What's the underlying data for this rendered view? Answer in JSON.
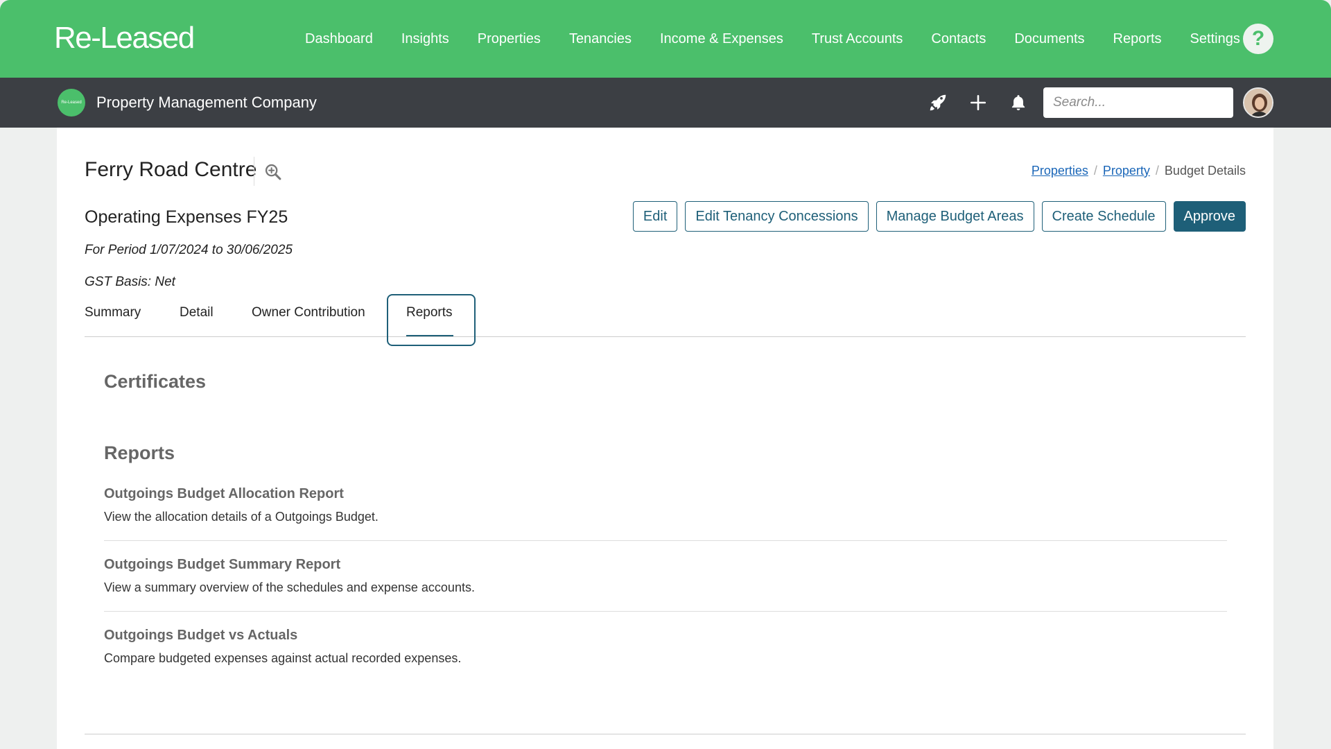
{
  "app": {
    "logo": "Re-Leased"
  },
  "topnav": {
    "items": [
      "Dashboard",
      "Insights",
      "Properties",
      "Tenancies",
      "Income & Expenses",
      "Trust Accounts",
      "Contacts",
      "Documents",
      "Reports",
      "Settings"
    ],
    "help_label": "?"
  },
  "companybar": {
    "logo_text": "Re-Leased",
    "company_name": "Property Management Company",
    "search_placeholder": "Search..."
  },
  "page": {
    "property_title": "Ferry Road Centre",
    "breadcrumb": [
      "Properties",
      "Property",
      "Budget Details"
    ],
    "budget_name": "Operating Expenses FY25",
    "period": "For Period 1/07/2024 to 30/06/2025",
    "gst_basis": "GST Basis: Net",
    "actions": [
      "Edit",
      "Edit Tenancy Concessions",
      "Manage Budget Areas",
      "Create Schedule",
      "Approve"
    ],
    "tabs": [
      "Summary",
      "Detail",
      "Owner Contribution",
      "Reports"
    ],
    "active_tab": "Reports"
  },
  "content": {
    "certificates_heading": "Certificates",
    "reports_heading": "Reports",
    "reports": [
      {
        "title": "Outgoings Budget Allocation Report",
        "desc": "View the allocation details of a Outgoings Budget."
      },
      {
        "title": "Outgoings Budget Summary Report",
        "desc": "View a summary overview of the schedules and expense accounts."
      },
      {
        "title": "Outgoings Budget vs Actuals",
        "desc": "Compare budgeted expenses against actual recorded expenses."
      }
    ]
  },
  "colors": {
    "brand_green": "#4bbf6b",
    "dark_bar": "#3c3f44",
    "accent": "#1e5f78"
  }
}
